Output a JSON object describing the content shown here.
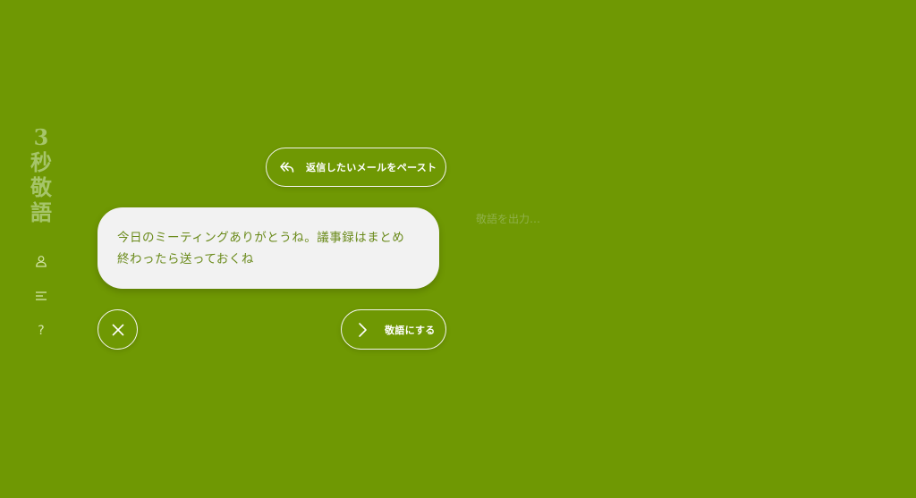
{
  "app": {
    "logo_chars": [
      "3",
      "秒",
      "敬",
      "語"
    ]
  },
  "sidebar": {
    "items": [
      {
        "icon": "user-icon"
      },
      {
        "icon": "menu-icon"
      },
      {
        "icon": "help-icon",
        "glyph": "?"
      }
    ]
  },
  "input": {
    "paste_button_label": "返信したいメールをペースト",
    "message_text_line1": "今日のミーティングありがとうね。議事録はまとめ",
    "message_text_line2": "終わったら送っておくね"
  },
  "actions": {
    "convert_label": "敬語にする"
  },
  "output": {
    "placeholder": "敬語を出力…"
  },
  "colors": {
    "background": "#6f9803",
    "card": "#f2f2f2",
    "card_text": "#6a8a1a",
    "logo": "#a6c56a"
  }
}
